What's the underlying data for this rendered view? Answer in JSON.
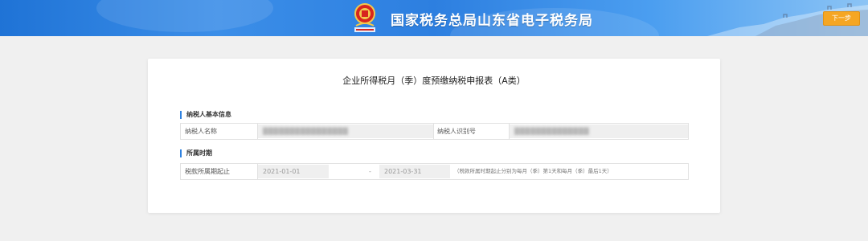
{
  "header": {
    "title": "国家税务总局山东省电子税务局",
    "next_button": "下一步",
    "emblem_icon": "tax-emblem-icon",
    "colors": {
      "banner": "#2d7fe0",
      "button": "#f5a623",
      "accent": "#2f82e0"
    }
  },
  "form": {
    "title": "企业所得税月（季）度预缴纳税申报表（A类）",
    "taxpayer_section": {
      "heading": "纳税人基本信息",
      "name_label": "纳税人名称",
      "name_value": "████████████████",
      "id_label": "纳税人识别号",
      "id_value": "██████████████"
    },
    "period_section": {
      "heading": "所属时期",
      "period_label": "税款所属期起止",
      "start_date": "2021-01-01",
      "separator": "-",
      "end_date": "2021-03-31",
      "hint": "（税款所属时期起止分别为每月（季）第1天和每月（季）最后1天）"
    }
  }
}
